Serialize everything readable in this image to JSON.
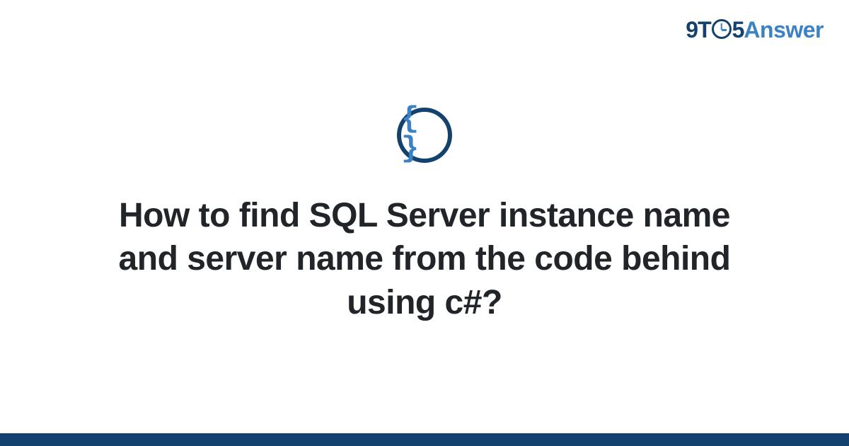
{
  "logo": {
    "part1": "9T",
    "part2": "5",
    "part3": "Answer"
  },
  "category": {
    "icon_name": "code-braces-icon",
    "symbol": "{ }"
  },
  "question": {
    "title": "How to find SQL Server instance name and server name from the code behind using c#?"
  },
  "colors": {
    "dark_blue": "#14426f",
    "light_blue": "#3b82c4",
    "text": "#212529"
  }
}
